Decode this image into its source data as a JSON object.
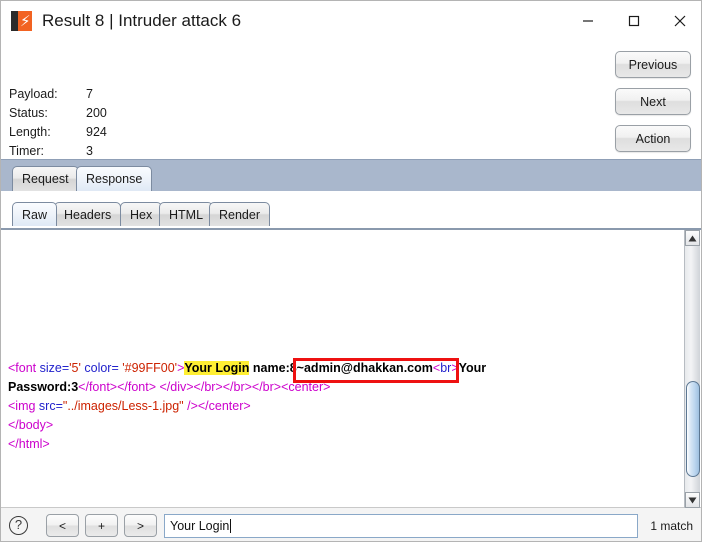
{
  "window": {
    "title": "Result 8 | Intruder attack 6",
    "app_icon": "burp-suite-icon",
    "minimize_label": "minimize-icon",
    "maximize_label": "maximize-icon",
    "close_label": "close-icon"
  },
  "info": {
    "rows": [
      {
        "label": "Payload:",
        "value": "7"
      },
      {
        "label": "Status:",
        "value": "200"
      },
      {
        "label": "Length:",
        "value": "924"
      },
      {
        "label": "Timer:",
        "value": "3"
      }
    ]
  },
  "side_buttons": {
    "previous": "Previous",
    "next": "Next",
    "action": "Action"
  },
  "main_tabs": [
    {
      "label": "Request",
      "active": false
    },
    {
      "label": "Response",
      "active": true
    }
  ],
  "sub_tabs": [
    {
      "label": "Raw",
      "active": true
    },
    {
      "label": "Headers",
      "active": false
    },
    {
      "label": "Hex",
      "active": false
    },
    {
      "label": "HTML",
      "active": false
    },
    {
      "label": "Render",
      "active": false
    }
  ],
  "response_body": {
    "line1": {
      "open_tag": "<font",
      "attr_size": " size=",
      "val_size": "'5'",
      "attr_color": " color= ",
      "val_color": "'#99FF00'",
      "close_bracket": ">",
      "highlight": "Your Login",
      "after_highlight": " name",
      "annotated": ":8~admin@dhakkan.com",
      "br_open": "<",
      "br_name": "br",
      "br_close": ">",
      "trailing": "Your"
    },
    "line2": {
      "text": "Password:3",
      "tags": "</font></font> </div></br></br></br><center>"
    },
    "line3": {
      "img_open": "<img",
      "attr_src": " src=",
      "val_src": "\"../images/Less-1.jpg\"",
      "self_close": " />",
      "center_close": "</center>"
    },
    "line4": "</body>",
    "line5": "</html>"
  },
  "annotation": {
    "color": "#ee1111",
    "target_text": ":8~admin@dhakkan.com<"
  },
  "scrollbar": {
    "up_arrow": "scroll-up-icon",
    "down_arrow": "scroll-down-icon"
  },
  "bottom_bar": {
    "help": "?",
    "prev_match": "<",
    "add_match": "+",
    "next_match": ">",
    "search_value": "Your Login",
    "search_placeholder": "",
    "match_count": "1 match"
  },
  "colors": {
    "accent_orange": "#f26322",
    "tag_magenta": "#cc00cc",
    "tagname_blue": "#2222cc",
    "value_red": "#cc2200",
    "highlight_yellow": "#ffef33",
    "tabstrip_blue_gray": "#a9b7cc",
    "annotation_red": "#ee1111"
  }
}
